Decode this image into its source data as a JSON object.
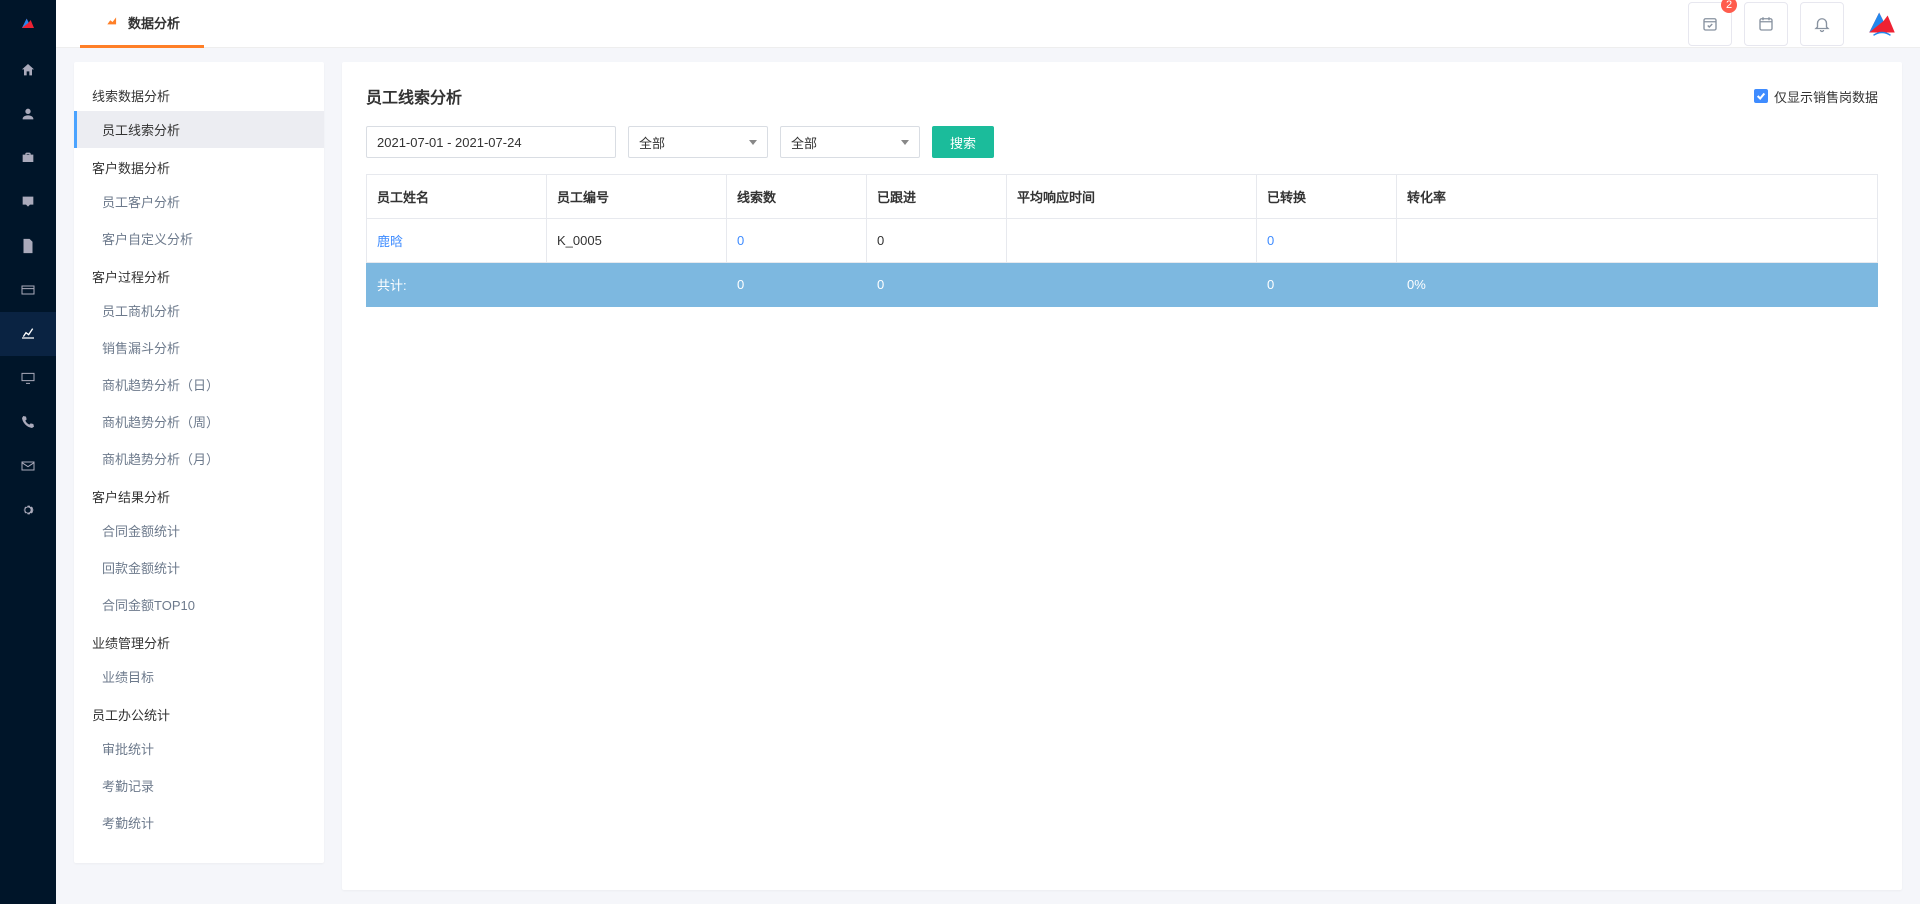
{
  "tab_title": "数据分析",
  "notif_badge": "2",
  "sidebar": {
    "groups": [
      {
        "title": "线索数据分析",
        "items": [
          {
            "label": "员工线索分析",
            "active": true
          }
        ]
      },
      {
        "title": "客户数据分析",
        "items": [
          {
            "label": "员工客户分析"
          },
          {
            "label": "客户自定义分析"
          }
        ]
      },
      {
        "title": "客户过程分析",
        "items": [
          {
            "label": "员工商机分析"
          },
          {
            "label": "销售漏斗分析"
          },
          {
            "label": "商机趋势分析（日）"
          },
          {
            "label": "商机趋势分析（周）"
          },
          {
            "label": "商机趋势分析（月）"
          }
        ]
      },
      {
        "title": "客户结果分析",
        "items": [
          {
            "label": "合同金额统计"
          },
          {
            "label": "回款金额统计"
          },
          {
            "label": "合同金额TOP10"
          }
        ]
      },
      {
        "title": "业绩管理分析",
        "items": [
          {
            "label": "业绩目标"
          }
        ]
      },
      {
        "title": "员工办公统计",
        "items": [
          {
            "label": "审批统计"
          },
          {
            "label": "考勤记录"
          },
          {
            "label": "考勤统计"
          }
        ]
      }
    ]
  },
  "panel": {
    "title": "员工线索分析",
    "checkbox_label": "仅显示销售岗数据",
    "date_range": "2021-07-01 - 2021-07-24",
    "select1": "全部",
    "select2": "全部",
    "search_btn": "搜索",
    "columns": [
      "员工姓名",
      "员工编号",
      "线索数",
      "已跟进",
      "平均响应时间",
      "已转换",
      "转化率"
    ],
    "rows": [
      {
        "name": "鹿晗",
        "code": "K_0005",
        "leads": "0",
        "followed": "0",
        "resp_time": "",
        "converted": "0",
        "rate": ""
      }
    ],
    "totals_label": "共计:",
    "totals": {
      "leads": "0",
      "followed": "0",
      "resp_time": "",
      "converted": "0",
      "rate": "0%"
    }
  }
}
